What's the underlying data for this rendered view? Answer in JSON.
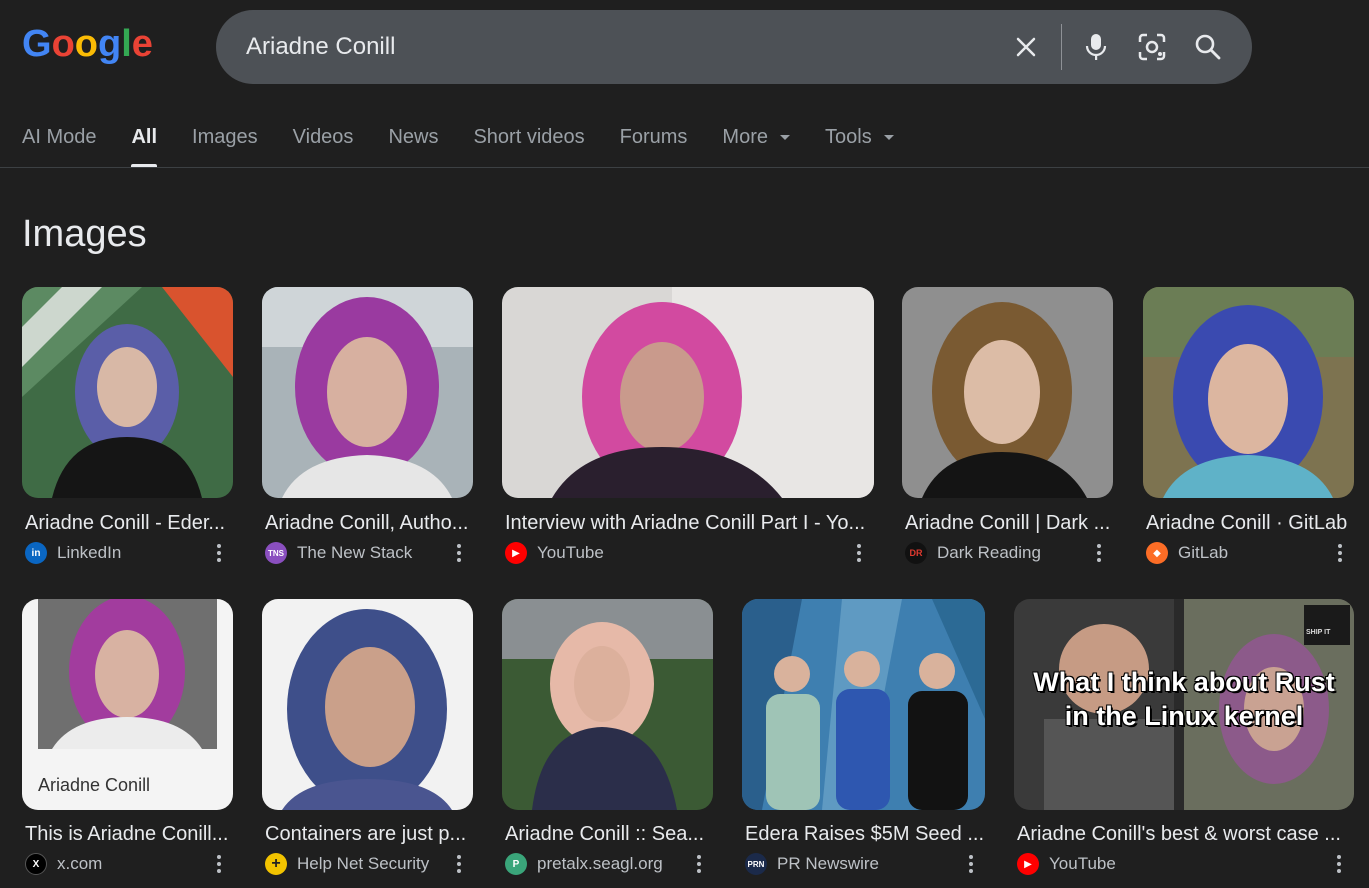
{
  "logo": {
    "text": "Google"
  },
  "search": {
    "query": "Ariadne Conill",
    "placeholder": ""
  },
  "tabs": [
    {
      "label": "AI Mode"
    },
    {
      "label": "All"
    },
    {
      "label": "Images"
    },
    {
      "label": "Videos"
    },
    {
      "label": "News"
    },
    {
      "label": "Short videos"
    },
    {
      "label": "Forums"
    },
    {
      "label": "More"
    },
    {
      "label": "Tools"
    }
  ],
  "section": {
    "title": "Images"
  },
  "images": [
    {
      "title": "Ariadne Conill - Eder...",
      "source": "LinkedIn",
      "favicon": "in",
      "favicon_color": "#0a66c2"
    },
    {
      "title": "Ariadne Conill, Autho...",
      "source": "The New Stack",
      "favicon": "TNS",
      "favicon_color": "#8a4fbf"
    },
    {
      "title": "Interview with Ariadne Conill Part I - Yo...",
      "source": "YouTube",
      "favicon": "▶",
      "favicon_color": "#ff0000"
    },
    {
      "title": "Ariadne Conill | Dark ...",
      "source": "Dark Reading",
      "favicon": "DR",
      "favicon_color": "#111111"
    },
    {
      "title": "Ariadne Conill · GitLab",
      "source": "GitLab",
      "favicon": "◆",
      "favicon_color": "#fc6d26"
    },
    {
      "title": "This is Ariadne Conill...",
      "source": "x.com",
      "favicon": "X",
      "favicon_color": "#000000",
      "caption": "Ariadne Conill"
    },
    {
      "title": "Containers are just p...",
      "source": "Help Net Security",
      "favicon": "+",
      "favicon_color": "#f2c300"
    },
    {
      "title": "Ariadne Conill :: Sea...",
      "source": "pretalx.seagl.org",
      "favicon": "P",
      "favicon_color": "#3aa57a"
    },
    {
      "title": "Edera Raises $5M Seed ...",
      "source": "PR Newswire",
      "favicon": "PRN",
      "favicon_color": "#1b2a4a"
    },
    {
      "title": "Ariadne Conill's best & worst case ...",
      "source": "YouTube",
      "favicon": "▶",
      "favicon_color": "#ff0000",
      "overlay_line1": "What I think about Rust",
      "overlay_line2": "in the Linux kernel",
      "badge": "SHIP IT"
    }
  ]
}
